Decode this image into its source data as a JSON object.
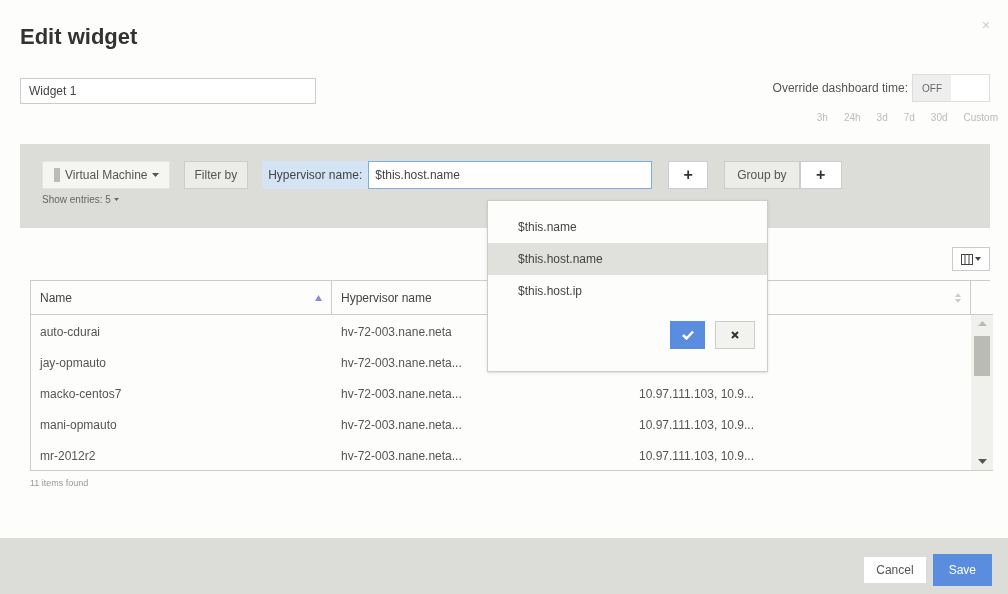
{
  "dialog": {
    "title": "Edit widget",
    "close": "×"
  },
  "widget_name": {
    "value": "Widget 1"
  },
  "override_time": {
    "label": "Override dashboard time:",
    "toggle": "OFF",
    "on": false,
    "ranges": [
      "3h",
      "24h",
      "3d",
      "7d",
      "30d",
      "Custom"
    ]
  },
  "toolbar": {
    "object_type": "Virtual Machine",
    "filter_by": "Filter by",
    "filter_field": "Hypervisor name:",
    "filter_value": "$this.host.name",
    "add_filter": "+",
    "group_by": "Group by",
    "add_group": "+",
    "show_entries": "Show entries:",
    "entries_count": "5"
  },
  "filter_dropdown": {
    "options": [
      {
        "label": "$this.name",
        "selected": false
      },
      {
        "label": "$this.host.name",
        "selected": true
      },
      {
        "label": "$this.host.ip",
        "selected": false
      }
    ]
  },
  "table": {
    "columns": [
      {
        "label": "Name",
        "sorted": true
      },
      {
        "label": "Hypervisor name"
      },
      {
        "sorted": false
      }
    ],
    "rows": [
      [
        "auto-cdurai",
        "hv-72-003.nane.neta",
        null
      ],
      [
        "jay-opmauto",
        "hv-72-003.nane.neta...",
        null
      ],
      [
        "macko-centos7",
        "hv-72-003.nane.neta...",
        "10.97.111.103, 10.9..."
      ],
      [
        "mani-opmauto",
        "hv-72-003.nane.neta...",
        "10.97.111.103, 10.9..."
      ],
      [
        "mr-2012r2",
        "hv-72-003.nane.neta...",
        "10.97.111.103, 10.9..."
      ]
    ]
  },
  "items_found": "11 items found",
  "buttons": {
    "cancel": "Cancel",
    "save": "Save"
  }
}
